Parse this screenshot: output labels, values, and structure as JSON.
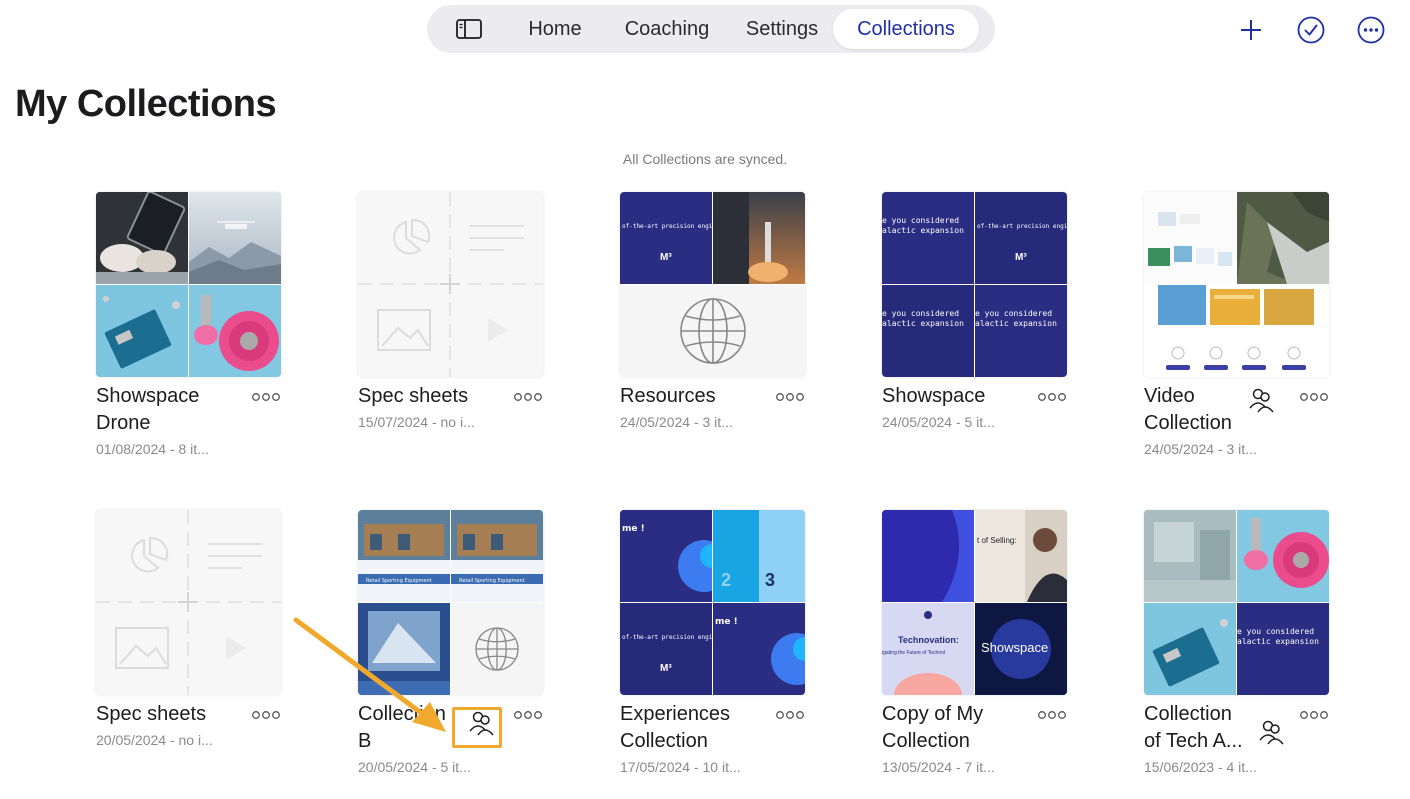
{
  "nav": {
    "tabs": [
      "Home",
      "Coaching",
      "Settings",
      "Collections"
    ],
    "active_tab": "Collections"
  },
  "page": {
    "title": "My Collections",
    "sync_status": "All Collections are synced."
  },
  "collections": [
    {
      "title": "Showspace Drone",
      "subtitle": "01/08/2024 - 8 it...",
      "shared": false
    },
    {
      "title": "Spec sheets",
      "subtitle": "15/07/2024 - no i...",
      "shared": false
    },
    {
      "title": "Resources",
      "subtitle": "24/05/2024 - 3 it...",
      "shared": false
    },
    {
      "title": "Showspace",
      "subtitle": "24/05/2024 - 5 it...",
      "shared": false
    },
    {
      "title": "Video Collection",
      "subtitle": "24/05/2024 - 3 it...",
      "shared": true
    },
    {
      "title": "Spec sheets",
      "subtitle": "20/05/2024 - no i...",
      "shared": false
    },
    {
      "title": "Collection B",
      "subtitle": "20/05/2024 - 5 it...",
      "shared": true
    },
    {
      "title": "Experiences Collection",
      "subtitle": "17/05/2024 - 10 it...",
      "shared": false
    },
    {
      "title": "Copy of My Collection",
      "subtitle": "13/05/2024 - 7 it...",
      "shared": false
    },
    {
      "title": "Collection of Tech A...",
      "subtitle": "15/06/2023 - 4 it...",
      "shared": true
    }
  ],
  "thumb_text": {
    "m3": "M³",
    "expansion_line1": "e you considered",
    "expansion_line2": "alactic expansion",
    "engineering": "of-the-art precision engineering",
    "retail": "Retail Sporting Equipment",
    "num2": "2",
    "num3": "3",
    "welcome": "me !",
    "selling": "t of Selling:",
    "technovation": "Technovation:",
    "future": "igating the Future of Technol",
    "showspace_logo": "Showspace"
  },
  "colors": {
    "accent": "#1f2fa6",
    "annotation": "#f0a92c",
    "navy": "#2b2d82"
  }
}
